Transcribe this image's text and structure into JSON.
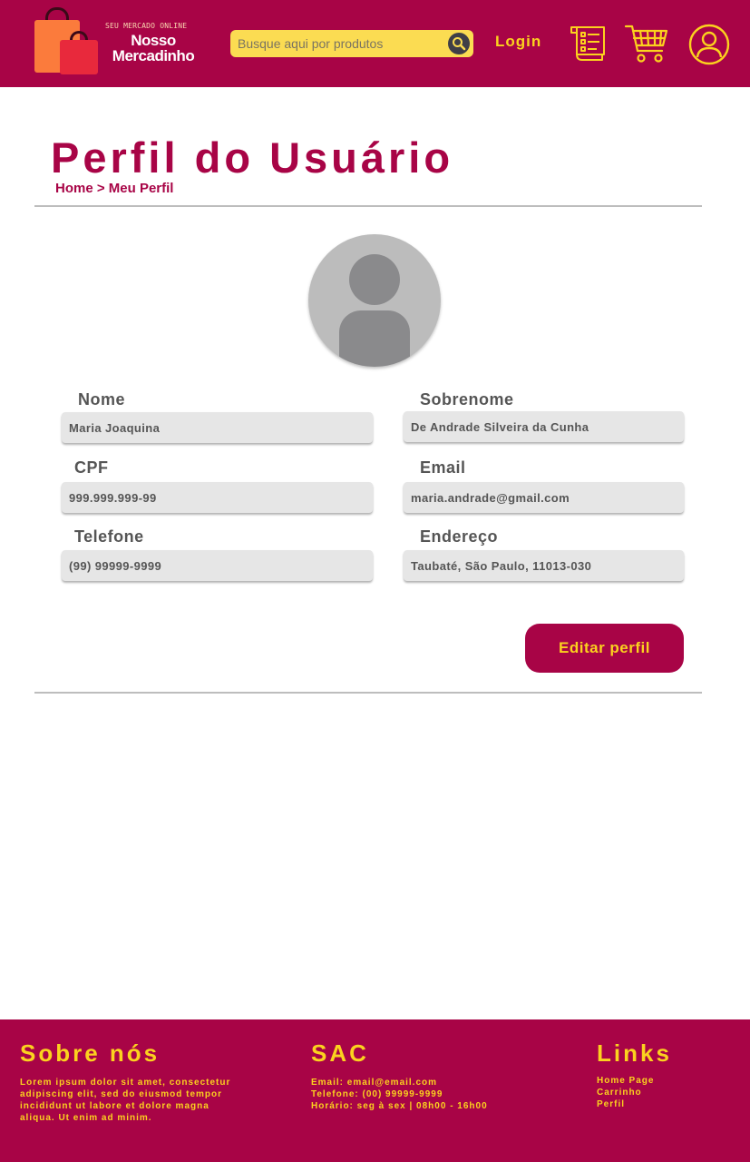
{
  "header": {
    "brand_tagline": "SEU MERCADO ONLINE",
    "brand_line1": "Nosso",
    "brand_line2": "Mercadinho",
    "search_placeholder": "Busque aqui por produtos",
    "login_label": "Login",
    "icons": [
      "orders-icon",
      "cart-icon",
      "user-account-icon"
    ]
  },
  "page": {
    "title": "Perfil do Usuário",
    "breadcrumb": [
      "Home",
      ">",
      "Meu Perfil"
    ]
  },
  "profile": {
    "fields": {
      "nome": {
        "label": "Nome",
        "value": "Maria Joaquina"
      },
      "sobrenome": {
        "label": "Sobrenome",
        "value": "De Andrade Silveira da Cunha"
      },
      "cpf": {
        "label": "CPF",
        "value": "999.999.999-99"
      },
      "email": {
        "label": "Email",
        "value": "maria.andrade@gmail.com"
      },
      "telefone": {
        "label": "Telefone",
        "value": "(99) 99999-9999"
      },
      "endereco": {
        "label": "Endereço",
        "value": "Taubaté, São Paulo, 11013-030"
      }
    },
    "edit_button": "Editar perfil"
  },
  "footer": {
    "about": {
      "title": "Sobre nós",
      "text": "Lorem ipsum dolor sit amet, consectetur adipiscing elit, sed do eiusmod tempor incididunt ut labore et dolore magna aliqua. Ut enim ad minim."
    },
    "sac": {
      "title": "SAC",
      "email": "Email: email@email.com",
      "phone": "Telefone: (00) 99999-9999",
      "hours": "Horário: seg à sex | 08h00 - 16h00"
    },
    "links": {
      "title": "Links",
      "items": [
        "Home Page",
        "Carrinho",
        "Perfil"
      ]
    }
  },
  "colors": {
    "primary": "#a80446",
    "accent": "#fbd21e",
    "search_bg": "#fbdc52",
    "field_bg": "#e6e6e6",
    "text_gray": "#555555"
  }
}
